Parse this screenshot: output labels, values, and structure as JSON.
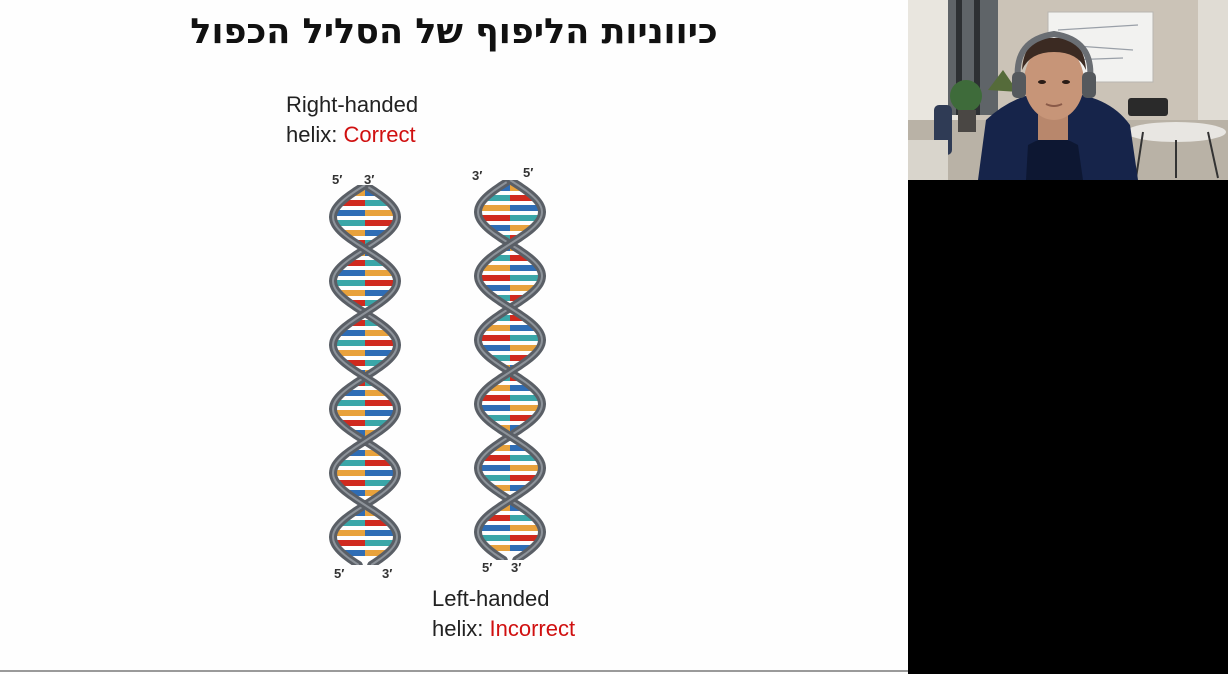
{
  "slide": {
    "title": "כיווניות הליפוף של הסליל הכפול",
    "right_helix": {
      "caption_line1": "Right-handed",
      "caption_line2_prefix": "helix: ",
      "caption_verdict": "Correct",
      "top_left_label": "5′",
      "top_right_label": "3′",
      "bottom_left_label": "5′",
      "bottom_right_label": "3′"
    },
    "left_helix": {
      "caption_line1": "Left-handed",
      "caption_line2_prefix": "helix: ",
      "caption_verdict": "Incorrect",
      "top_left_label": "3′",
      "top_right_label": "5′",
      "bottom_left_label": "5′",
      "bottom_right_label": "3′"
    }
  },
  "colors": {
    "verdict": "#d01010",
    "backbone": "#5a5f66",
    "base_pairs": [
      "#2f6db5",
      "#3aa6a8",
      "#e8a23c",
      "#d02a1e"
    ]
  },
  "webcam": {
    "description_icon": "presenter-video-feed"
  }
}
